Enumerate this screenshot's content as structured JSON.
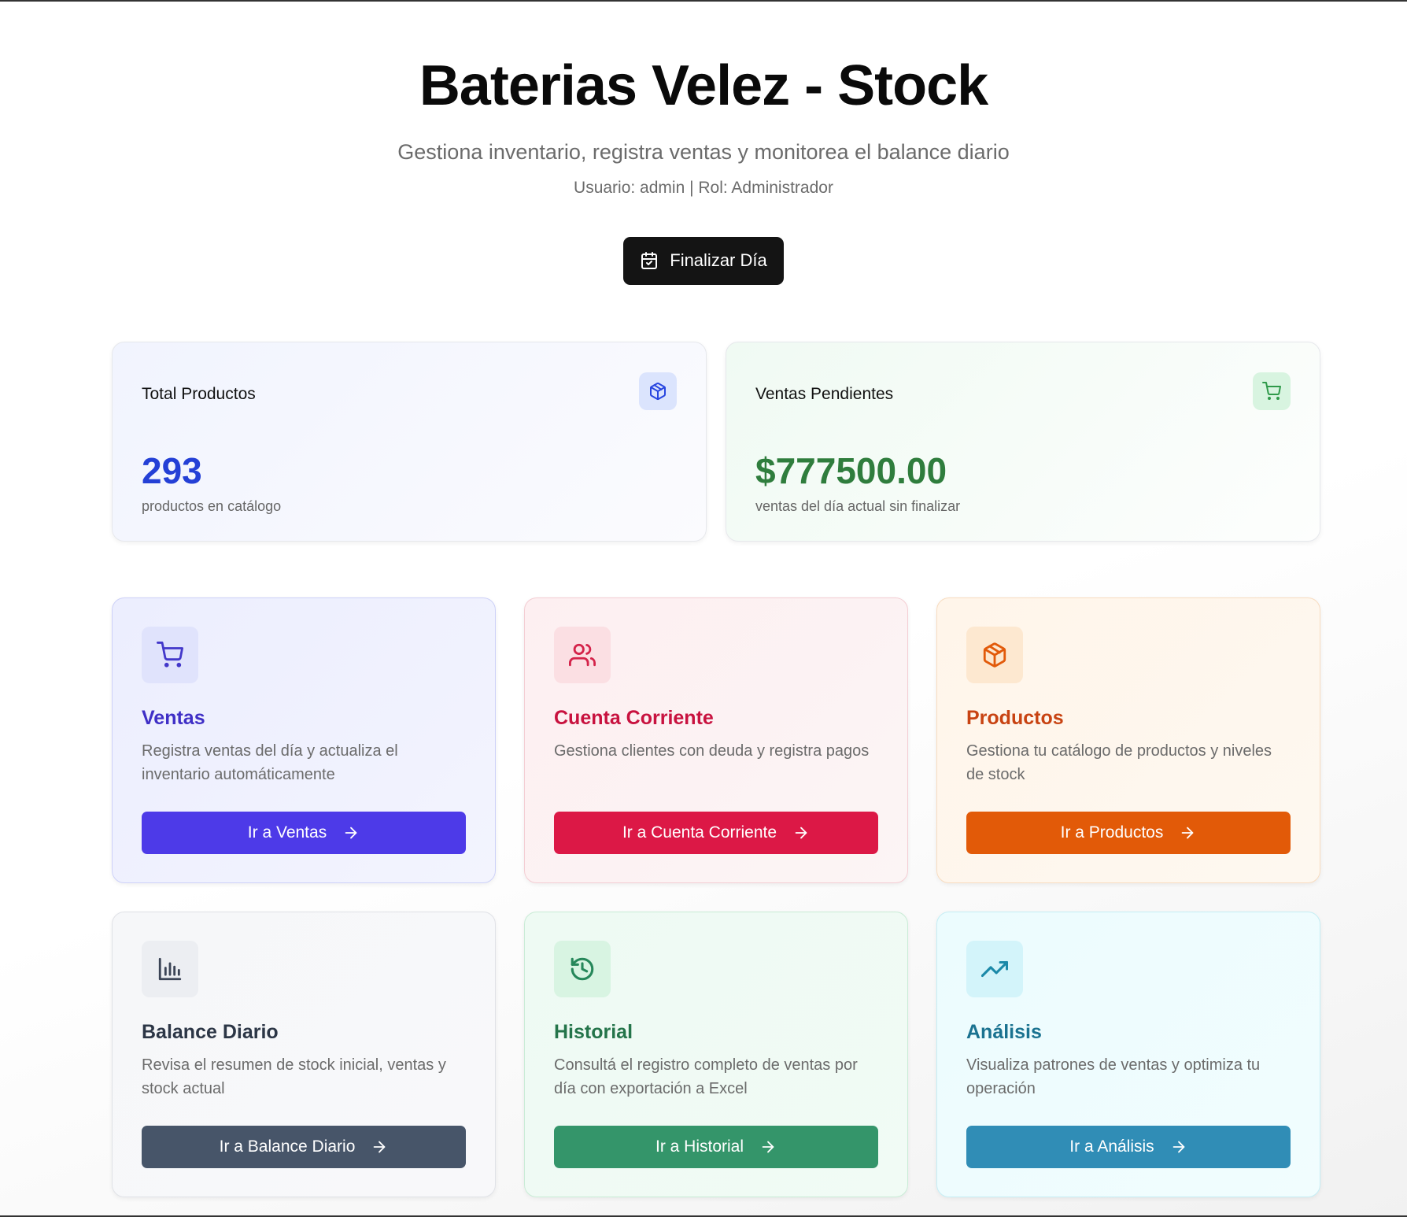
{
  "header": {
    "title": "Baterias Velez - Stock",
    "subtitle": "Gestiona inventario, registra ventas y monitorea el balance diario",
    "user_info": "Usuario: admin | Rol: Administrador",
    "finalize_label": "Finalizar Día"
  },
  "stats": {
    "products": {
      "title": "Total Productos",
      "value": "293",
      "description": "productos en catálogo",
      "icon": "package-icon",
      "color": "#2440d6"
    },
    "sales": {
      "title": "Ventas Pendientes",
      "value": "$777500.00",
      "description": "ventas del día actual sin finalizar",
      "icon": "shopping-cart-icon",
      "color": "#2f7d3d"
    }
  },
  "modules": [
    {
      "title": "Ventas",
      "description": "Registra ventas del día y actualiza el inventario automáticamente",
      "button": "Ir a Ventas",
      "icon": "shopping-cart-icon",
      "color": "#4d3ae8"
    },
    {
      "title": "Cuenta Corriente",
      "description": "Gestiona clientes con deuda y registra pagos",
      "button": "Ir a Cuenta Corriente",
      "icon": "users-icon",
      "color": "#dc1846"
    },
    {
      "title": "Productos",
      "description": "Gestiona tu catálogo de productos y niveles de stock",
      "button": "Ir a Productos",
      "icon": "package-icon",
      "color": "#e25a08"
    },
    {
      "title": "Balance Diario",
      "description": "Revisa el resumen de stock inicial, ventas y stock actual",
      "button": "Ir a Balance Diario",
      "icon": "bar-chart-icon",
      "color": "#475569"
    },
    {
      "title": "Historial",
      "description": "Consultá el registro completo de ventas por día con exportación a Excel",
      "button": "Ir a Historial",
      "icon": "history-icon",
      "color": "#34956a"
    },
    {
      "title": "Análisis",
      "description": "Visualiza patrones de ventas y optimiza tu operación",
      "button": "Ir a Análisis",
      "icon": "trending-up-icon",
      "color": "#308db6"
    }
  ]
}
